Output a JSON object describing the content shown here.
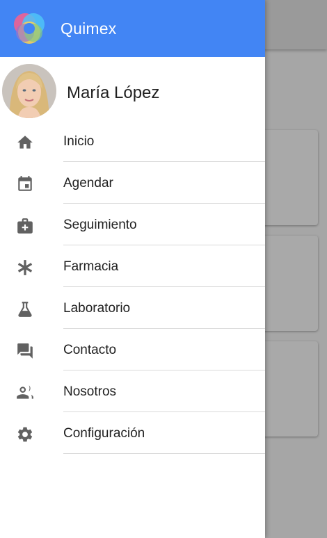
{
  "app": {
    "title": "Quimex"
  },
  "user": {
    "name": "María López"
  },
  "menu": [
    {
      "label": "Inicio",
      "icon": "home-icon"
    },
    {
      "label": "Agendar",
      "icon": "calendar-icon"
    },
    {
      "label": "Seguimiento",
      "icon": "medkit-icon"
    },
    {
      "label": "Farmacia",
      "icon": "asterisk-icon"
    },
    {
      "label": "Laboratorio",
      "icon": "flask-icon"
    },
    {
      "label": "Contacto",
      "icon": "chat-icon"
    },
    {
      "label": "Nosotros",
      "icon": "people-icon"
    },
    {
      "label": "Configuración",
      "icon": "gear-icon"
    }
  ],
  "colors": {
    "header": "#4285f4",
    "icon": "#616161",
    "overlay": "#9e9e9e"
  }
}
